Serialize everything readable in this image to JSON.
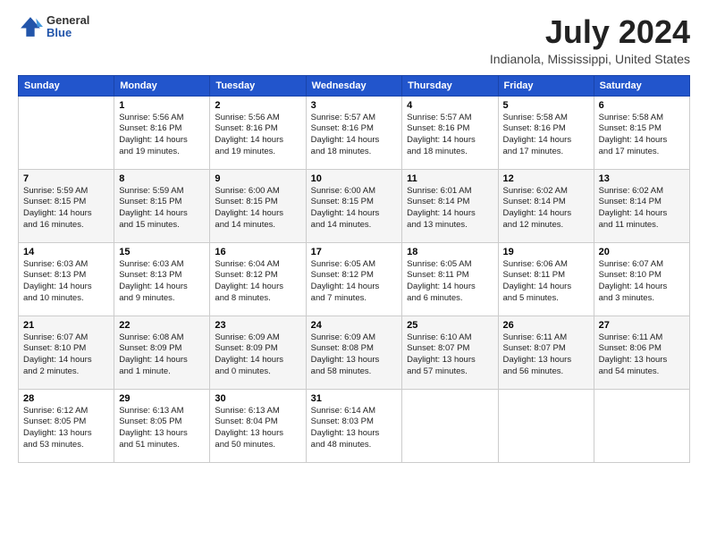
{
  "logo": {
    "general": "General",
    "blue": "Blue"
  },
  "header": {
    "month_year": "July 2024",
    "location": "Indianola, Mississippi, United States"
  },
  "weekdays": [
    "Sunday",
    "Monday",
    "Tuesday",
    "Wednesday",
    "Thursday",
    "Friday",
    "Saturday"
  ],
  "weeks": [
    [
      {
        "day": "",
        "info": ""
      },
      {
        "day": "1",
        "info": "Sunrise: 5:56 AM\nSunset: 8:16 PM\nDaylight: 14 hours\nand 19 minutes."
      },
      {
        "day": "2",
        "info": "Sunrise: 5:56 AM\nSunset: 8:16 PM\nDaylight: 14 hours\nand 19 minutes."
      },
      {
        "day": "3",
        "info": "Sunrise: 5:57 AM\nSunset: 8:16 PM\nDaylight: 14 hours\nand 18 minutes."
      },
      {
        "day": "4",
        "info": "Sunrise: 5:57 AM\nSunset: 8:16 PM\nDaylight: 14 hours\nand 18 minutes."
      },
      {
        "day": "5",
        "info": "Sunrise: 5:58 AM\nSunset: 8:16 PM\nDaylight: 14 hours\nand 17 minutes."
      },
      {
        "day": "6",
        "info": "Sunrise: 5:58 AM\nSunset: 8:15 PM\nDaylight: 14 hours\nand 17 minutes."
      }
    ],
    [
      {
        "day": "7",
        "info": "Sunrise: 5:59 AM\nSunset: 8:15 PM\nDaylight: 14 hours\nand 16 minutes."
      },
      {
        "day": "8",
        "info": "Sunrise: 5:59 AM\nSunset: 8:15 PM\nDaylight: 14 hours\nand 15 minutes."
      },
      {
        "day": "9",
        "info": "Sunrise: 6:00 AM\nSunset: 8:15 PM\nDaylight: 14 hours\nand 14 minutes."
      },
      {
        "day": "10",
        "info": "Sunrise: 6:00 AM\nSunset: 8:15 PM\nDaylight: 14 hours\nand 14 minutes."
      },
      {
        "day": "11",
        "info": "Sunrise: 6:01 AM\nSunset: 8:14 PM\nDaylight: 14 hours\nand 13 minutes."
      },
      {
        "day": "12",
        "info": "Sunrise: 6:02 AM\nSunset: 8:14 PM\nDaylight: 14 hours\nand 12 minutes."
      },
      {
        "day": "13",
        "info": "Sunrise: 6:02 AM\nSunset: 8:14 PM\nDaylight: 14 hours\nand 11 minutes."
      }
    ],
    [
      {
        "day": "14",
        "info": "Sunrise: 6:03 AM\nSunset: 8:13 PM\nDaylight: 14 hours\nand 10 minutes."
      },
      {
        "day": "15",
        "info": "Sunrise: 6:03 AM\nSunset: 8:13 PM\nDaylight: 14 hours\nand 9 minutes."
      },
      {
        "day": "16",
        "info": "Sunrise: 6:04 AM\nSunset: 8:12 PM\nDaylight: 14 hours\nand 8 minutes."
      },
      {
        "day": "17",
        "info": "Sunrise: 6:05 AM\nSunset: 8:12 PM\nDaylight: 14 hours\nand 7 minutes."
      },
      {
        "day": "18",
        "info": "Sunrise: 6:05 AM\nSunset: 8:11 PM\nDaylight: 14 hours\nand 6 minutes."
      },
      {
        "day": "19",
        "info": "Sunrise: 6:06 AM\nSunset: 8:11 PM\nDaylight: 14 hours\nand 5 minutes."
      },
      {
        "day": "20",
        "info": "Sunrise: 6:07 AM\nSunset: 8:10 PM\nDaylight: 14 hours\nand 3 minutes."
      }
    ],
    [
      {
        "day": "21",
        "info": "Sunrise: 6:07 AM\nSunset: 8:10 PM\nDaylight: 14 hours\nand 2 minutes."
      },
      {
        "day": "22",
        "info": "Sunrise: 6:08 AM\nSunset: 8:09 PM\nDaylight: 14 hours\nand 1 minute."
      },
      {
        "day": "23",
        "info": "Sunrise: 6:09 AM\nSunset: 8:09 PM\nDaylight: 14 hours\nand 0 minutes."
      },
      {
        "day": "24",
        "info": "Sunrise: 6:09 AM\nSunset: 8:08 PM\nDaylight: 13 hours\nand 58 minutes."
      },
      {
        "day": "25",
        "info": "Sunrise: 6:10 AM\nSunset: 8:07 PM\nDaylight: 13 hours\nand 57 minutes."
      },
      {
        "day": "26",
        "info": "Sunrise: 6:11 AM\nSunset: 8:07 PM\nDaylight: 13 hours\nand 56 minutes."
      },
      {
        "day": "27",
        "info": "Sunrise: 6:11 AM\nSunset: 8:06 PM\nDaylight: 13 hours\nand 54 minutes."
      }
    ],
    [
      {
        "day": "28",
        "info": "Sunrise: 6:12 AM\nSunset: 8:05 PM\nDaylight: 13 hours\nand 53 minutes."
      },
      {
        "day": "29",
        "info": "Sunrise: 6:13 AM\nSunset: 8:05 PM\nDaylight: 13 hours\nand 51 minutes."
      },
      {
        "day": "30",
        "info": "Sunrise: 6:13 AM\nSunset: 8:04 PM\nDaylight: 13 hours\nand 50 minutes."
      },
      {
        "day": "31",
        "info": "Sunrise: 6:14 AM\nSunset: 8:03 PM\nDaylight: 13 hours\nand 48 minutes."
      },
      {
        "day": "",
        "info": ""
      },
      {
        "day": "",
        "info": ""
      },
      {
        "day": "",
        "info": ""
      }
    ]
  ]
}
